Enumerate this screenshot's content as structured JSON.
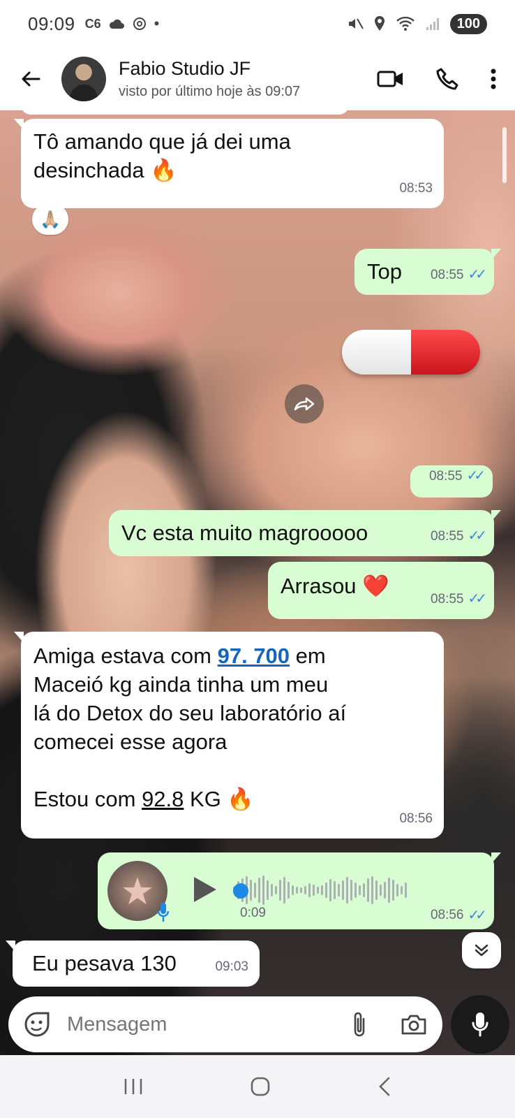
{
  "status_bar": {
    "time": "09:09",
    "left_badge": "C6",
    "battery": "100",
    "icons": [
      "c6-bank-icon",
      "cloud-icon",
      "openai-icon",
      "dot-icon",
      "mute-icon",
      "location-icon",
      "wifi-icon",
      "signal-icon",
      "battery-icon"
    ]
  },
  "header": {
    "contact_name": "Fabio Studio JF",
    "last_seen": "visto por último hoje às 09:07",
    "icons": [
      "back-arrow-icon",
      "video-call-icon",
      "phone-icon",
      "more-vert-icon"
    ]
  },
  "messages": [
    {
      "id": "m1",
      "direction": "in",
      "lines": [
        "Tô amando que já dei uma",
        "desinchada 🔥"
      ],
      "time": "08:53",
      "reaction": "🙏🏼"
    },
    {
      "id": "m2",
      "direction": "out",
      "text": "Top",
      "time": "08:55",
      "status": "read"
    },
    {
      "id": "m3",
      "direction": "out",
      "type": "sticker",
      "sticker": "pill-capsule",
      "time": "08:55",
      "status": "read"
    },
    {
      "id": "m4",
      "direction": "out",
      "text": "Vc esta muito magrooooo",
      "time": "08:55",
      "status": "read"
    },
    {
      "id": "m5",
      "direction": "out",
      "text": "Arrasou ❤️",
      "time": "08:55",
      "status": "read"
    },
    {
      "id": "m6",
      "direction": "in",
      "parts": {
        "l1_a": "Amiga estava com ",
        "l1_link": "97. 700",
        "l1_b": " em",
        "l2": "Maceió kg ainda tinha um meu",
        "l3": "lá do Detox do seu laboratório aí",
        "l4": "comecei esse agora",
        "l5_a": "Estou com ",
        "l5_num": "92.8",
        "l5_b": " KG 🔥"
      },
      "time": "08:56"
    },
    {
      "id": "m7",
      "direction": "out",
      "type": "voice",
      "duration": "0:09",
      "time": "08:56",
      "status": "read"
    },
    {
      "id": "m8",
      "direction": "in",
      "text": "Eu pesava 130",
      "time": "09:03"
    }
  ],
  "ticks": "✓✓",
  "input": {
    "placeholder": "Mensagem"
  },
  "colors": {
    "incoming_bubble": "#ffffff",
    "outgoing_bubble": "#d9fdd3",
    "read_ticks": "#3b8ad8",
    "link": "#1565c0",
    "mic_button": "#1a1a1a"
  },
  "nav": {
    "icons": [
      "recent-apps-icon",
      "home-icon",
      "back-nav-icon"
    ]
  }
}
